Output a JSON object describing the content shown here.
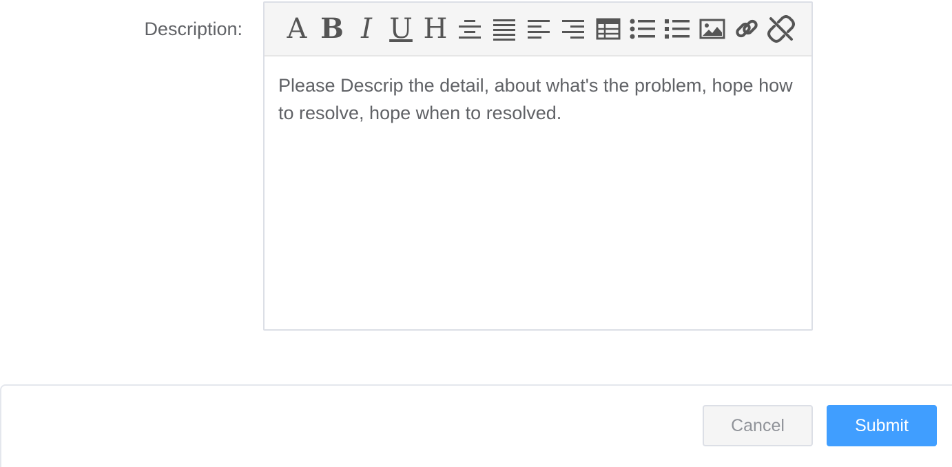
{
  "form": {
    "description_label": "Description:"
  },
  "editor": {
    "toolbar": {
      "font": "A",
      "bold": "B",
      "italic": "I",
      "underline": "U",
      "heading": "H"
    },
    "content": "Please Descrip the detail, about what's the problem, hope how to resolve, hope when to resolved."
  },
  "footer": {
    "cancel_label": "Cancel",
    "submit_label": "Submit"
  },
  "colors": {
    "primary": "#409eff",
    "text": "#606266",
    "icon": "#555555"
  }
}
